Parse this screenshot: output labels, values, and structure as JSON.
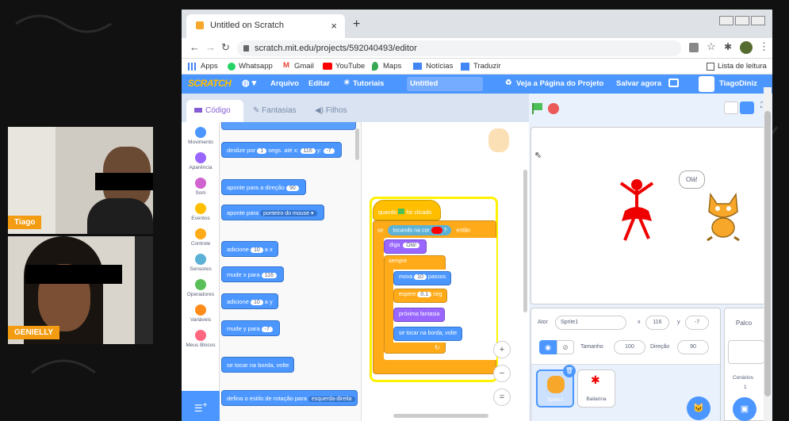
{
  "participants": [
    {
      "name": "Tiago"
    },
    {
      "name": "GENIELLY"
    }
  ],
  "browser": {
    "tab_title": "Untitled on Scratch",
    "tab_close": "×",
    "new_tab": "+",
    "url": "scratch.mit.edu/projects/592040493/editor",
    "bookmarks": [
      "Apps",
      "Whatsapp",
      "Gmail",
      "YouTube",
      "Maps",
      "Notícias",
      "Traduzir"
    ],
    "reading_list": "Lista de leitura"
  },
  "scratch": {
    "menu": {
      "logo": "SCRATCH",
      "file": "Arquivo",
      "edit": "Editar",
      "tutorials": "Tutoriais",
      "project_title": "Untitled",
      "see_project": "Veja a Página do Projeto",
      "save": "Salvar agora",
      "user": "TiagoDiniz"
    },
    "tabs": {
      "code": "Código",
      "costumes": "Fantasias",
      "sounds": "Filhos"
    },
    "categories": [
      {
        "label": "Movimento",
        "color": "#4c97ff"
      },
      {
        "label": "Aparência",
        "color": "#9966ff"
      },
      {
        "label": "Som",
        "color": "#cf63cf"
      },
      {
        "label": "Eventos",
        "color": "#ffbf00"
      },
      {
        "label": "Controle",
        "color": "#ffab19"
      },
      {
        "label": "Sensores",
        "color": "#5cb1d6"
      },
      {
        "label": "Operadores",
        "color": "#59c059"
      },
      {
        "label": "Variáveis",
        "color": "#ff8c1a"
      },
      {
        "label": "Meus Blocos",
        "color": "#ff6680"
      }
    ],
    "palette": {
      "b1a": "deslize por",
      "b1b": "1",
      "b1c": "segs. até x:",
      "b1d": "116",
      "b1e": "y:",
      "b1f": "-7",
      "b2a": "aponte para a direção",
      "b2b": "90",
      "b3a": "aponte para",
      "b3b": "ponteiro do mouse ▾",
      "b4a": "adicione",
      "b4b": "10",
      "b4c": "a x",
      "b5a": "mude x para",
      "b5b": "116",
      "b6a": "adicione",
      "b6b": "10",
      "b6c": "a y",
      "b7a": "mude y para",
      "b7b": "-7",
      "b8a": "se tocar na borda, volte",
      "b9a": "defina o estilo de rotação para",
      "b9b": "esquerda-direita"
    },
    "script": {
      "hat": "quando",
      "hat2": "for clicado",
      "if": "se",
      "touching": "tocando na cor",
      "ifend": "então",
      "say": "diga",
      "say_text": "Olá!",
      "forever": "sempre",
      "move": "mova",
      "move_n": "10",
      "move_unit": "passos",
      "wait": "espere",
      "wait_n": "0.1",
      "wait_unit": "seg",
      "next_costume": "próxima fantasia",
      "bounce": "se tocar na borda, volte"
    },
    "stage": {
      "speech": "Olá!"
    },
    "sprite_info": {
      "actor_label": "Ator",
      "actor": "Sprite1",
      "x_label": "x",
      "x": "116",
      "y_label": "y",
      "y": "-7",
      "show_label": "Mostrar",
      "size_label": "Tamanho",
      "size": "100",
      "dir_label": "Direção",
      "dir": "90"
    },
    "sprites": [
      "Sprite1",
      "Bailarina"
    ],
    "stage_pane": {
      "title": "Palco",
      "backdrops_label": "Cenários",
      "backdrops": "1"
    },
    "zoom": {
      "in": "+",
      "out": "−",
      "reset": "="
    }
  }
}
